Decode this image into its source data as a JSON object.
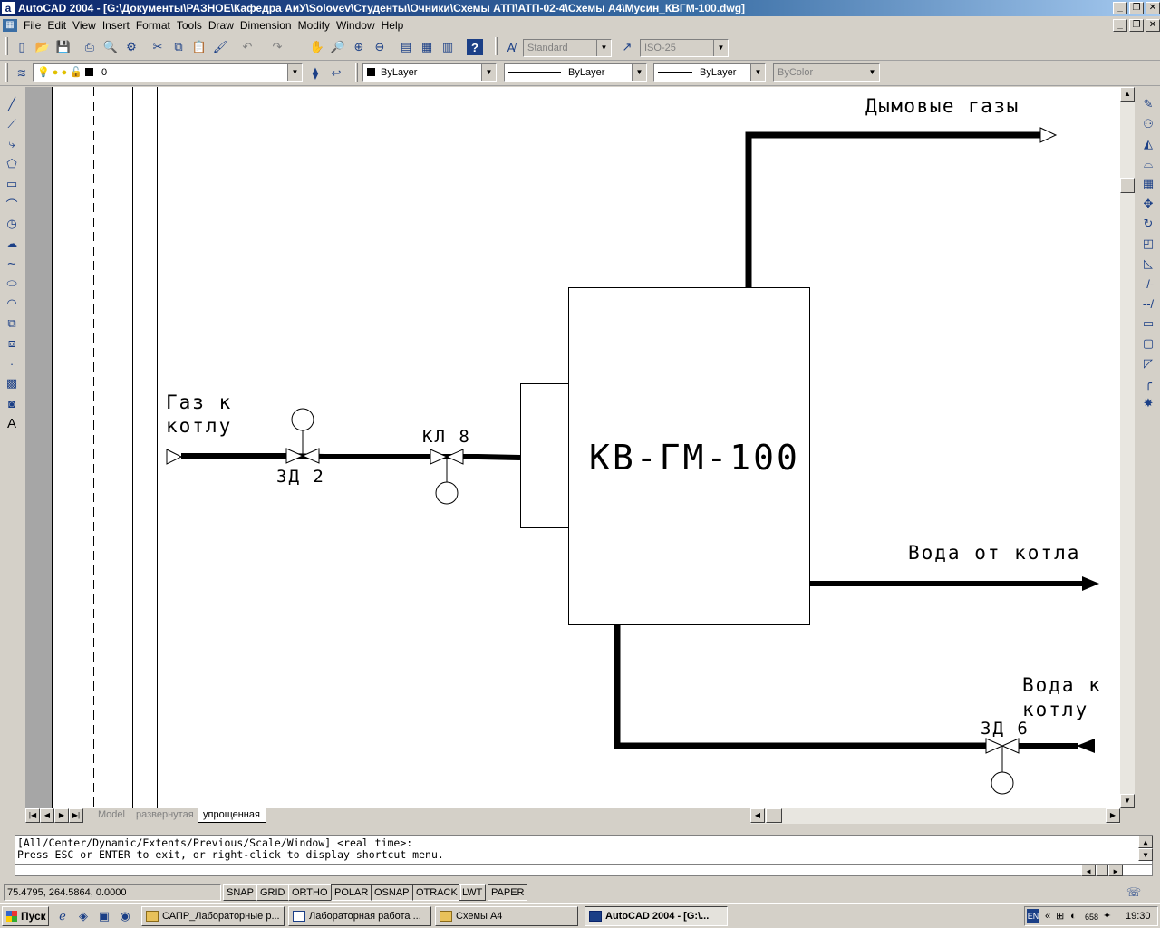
{
  "window": {
    "title": "AutoCAD 2004 - [G:\\Документы\\РАЗНОЕ\\Кафедра АиУ\\Solovev\\Студенты\\Очники\\Схемы АТП\\АТП-02-4\\Схемы А4\\Мусин_КВГМ-100.dwg]",
    "app_icon": "a"
  },
  "menu": {
    "items": [
      "File",
      "Edit",
      "View",
      "Insert",
      "Format",
      "Tools",
      "Draw",
      "Dimension",
      "Modify",
      "Window",
      "Help"
    ]
  },
  "toolbar": {
    "text_style": "Standard",
    "dim_style": "ISO-25",
    "layer": "0",
    "color": "ByLayer",
    "linetype": "ByLayer",
    "lineweight": "ByLayer",
    "plotstyle": "ByColor"
  },
  "drawing": {
    "labels": {
      "flue_gas": "Дымовые газы",
      "gas_to_boiler_1": "Газ к",
      "gas_to_boiler_2": "котлу",
      "valve_zd2": "ЗД 2",
      "valve_kl8": "КЛ 8",
      "boiler": "КВ-ГМ-100",
      "water_from_boiler": "Вода от котла",
      "water_to_boiler_1": "Вода к",
      "water_to_boiler_2": "котлу",
      "valve_zd6": "ЗД 6"
    }
  },
  "layout_tabs": [
    "Model",
    "развернутая",
    "упрощенная"
  ],
  "active_tab": "упрощенная",
  "command": {
    "line1": "[All/Center/Dynamic/Extents/Previous/Scale/Window] <real time>:",
    "line2": "Press ESC or ENTER to exit, or right-click to display shortcut menu."
  },
  "status": {
    "coords": "75.4795, 264.5864, 0.0000",
    "toggles": [
      "SNAP",
      "GRID",
      "ORTHO",
      "POLAR",
      "OSNAP",
      "OTRACK",
      "LWT",
      "PAPER"
    ],
    "toggles_on": [
      "POLAR",
      "OSNAP",
      "OTRACK",
      "PAPER"
    ]
  },
  "taskbar": {
    "start": "Пуск",
    "tasks": [
      "САПР_Лабораторные р...",
      "Лабораторная работа ...",
      "Схемы А4",
      "AutoCAD 2004 - [G:\\..."
    ],
    "active_task": "AutoCAD 2004 - [G:\\...",
    "tray_lang": "EN",
    "tray_num": "658",
    "clock": "19:30"
  }
}
